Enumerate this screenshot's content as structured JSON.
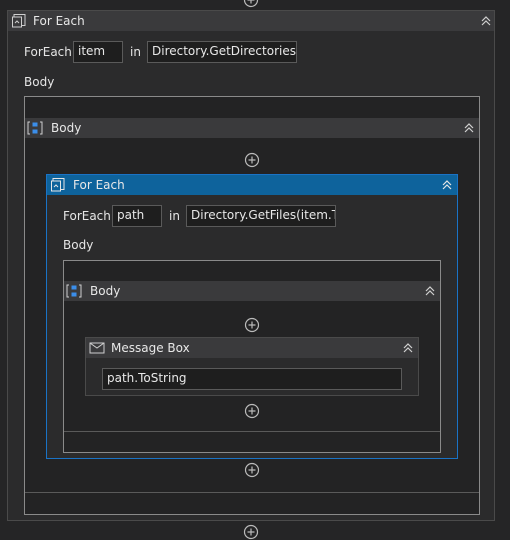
{
  "outer_foreach": {
    "title": "For Each",
    "foreach_label": "ForEach",
    "item_value": "item",
    "in_label": "in",
    "collection_value": "Directory.GetDirectories(\"D",
    "body_label": "Body",
    "sequence_title": "Body"
  },
  "inner_foreach": {
    "title": "For Each",
    "foreach_label": "ForEach",
    "item_value": "path",
    "in_label": "in",
    "collection_value": "Directory.GetFiles(item.ToS",
    "body_label": "Body",
    "sequence_title": "Body"
  },
  "message_box": {
    "title": "Message Box",
    "text_value": "path.ToString"
  },
  "colors": {
    "canvas": "#252526",
    "activity_header": "#3a3a3c",
    "selected_header": "#0e639c",
    "border": "#4a4a4a"
  }
}
